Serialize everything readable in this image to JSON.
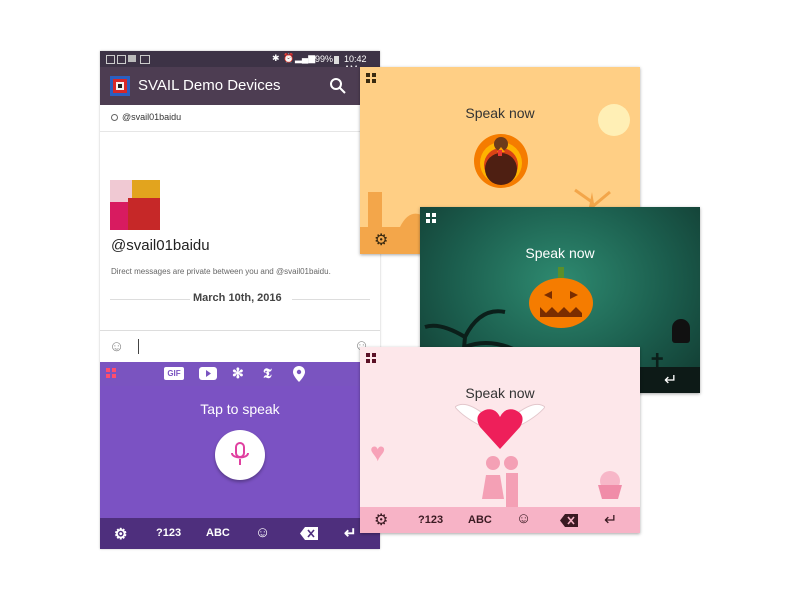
{
  "status_bar": {
    "battery": "99%",
    "time": "10:42 AM"
  },
  "app_bar": {
    "title": "SVAIL Demo Devices"
  },
  "channel_row": {
    "handle": "@svail01baidu"
  },
  "profile": {
    "name": "@svail01baidu",
    "dm_notice": "Direct messages are private between you and @svail01baidu.",
    "date": "March 10th, 2016"
  },
  "purple_keyboard": {
    "top_icons": [
      "grid-icon",
      "gif-icon",
      "youtube-icon",
      "yelp-icon",
      "nytimes-icon",
      "location-pin-icon"
    ],
    "gif_label": "GIF",
    "nyt_label": "𝕿",
    "prompt": "Tap to speak",
    "bottom": {
      "num_label": "?123",
      "abc_label": "ABC"
    },
    "colors": {
      "top": "#7a54c0",
      "main": "#7b52c3",
      "bottom": "#4e2f7d"
    }
  },
  "thanksgiving_card": {
    "prompt": "Speak now",
    "background": "#ffcf85"
  },
  "halloween_card": {
    "prompt": "Speak now",
    "background": "#1f6e5c"
  },
  "valentine_card": {
    "prompt": "Speak now",
    "background": "#fde7ea",
    "bottom": {
      "num_label": "?123",
      "abc_label": "ABC"
    }
  }
}
